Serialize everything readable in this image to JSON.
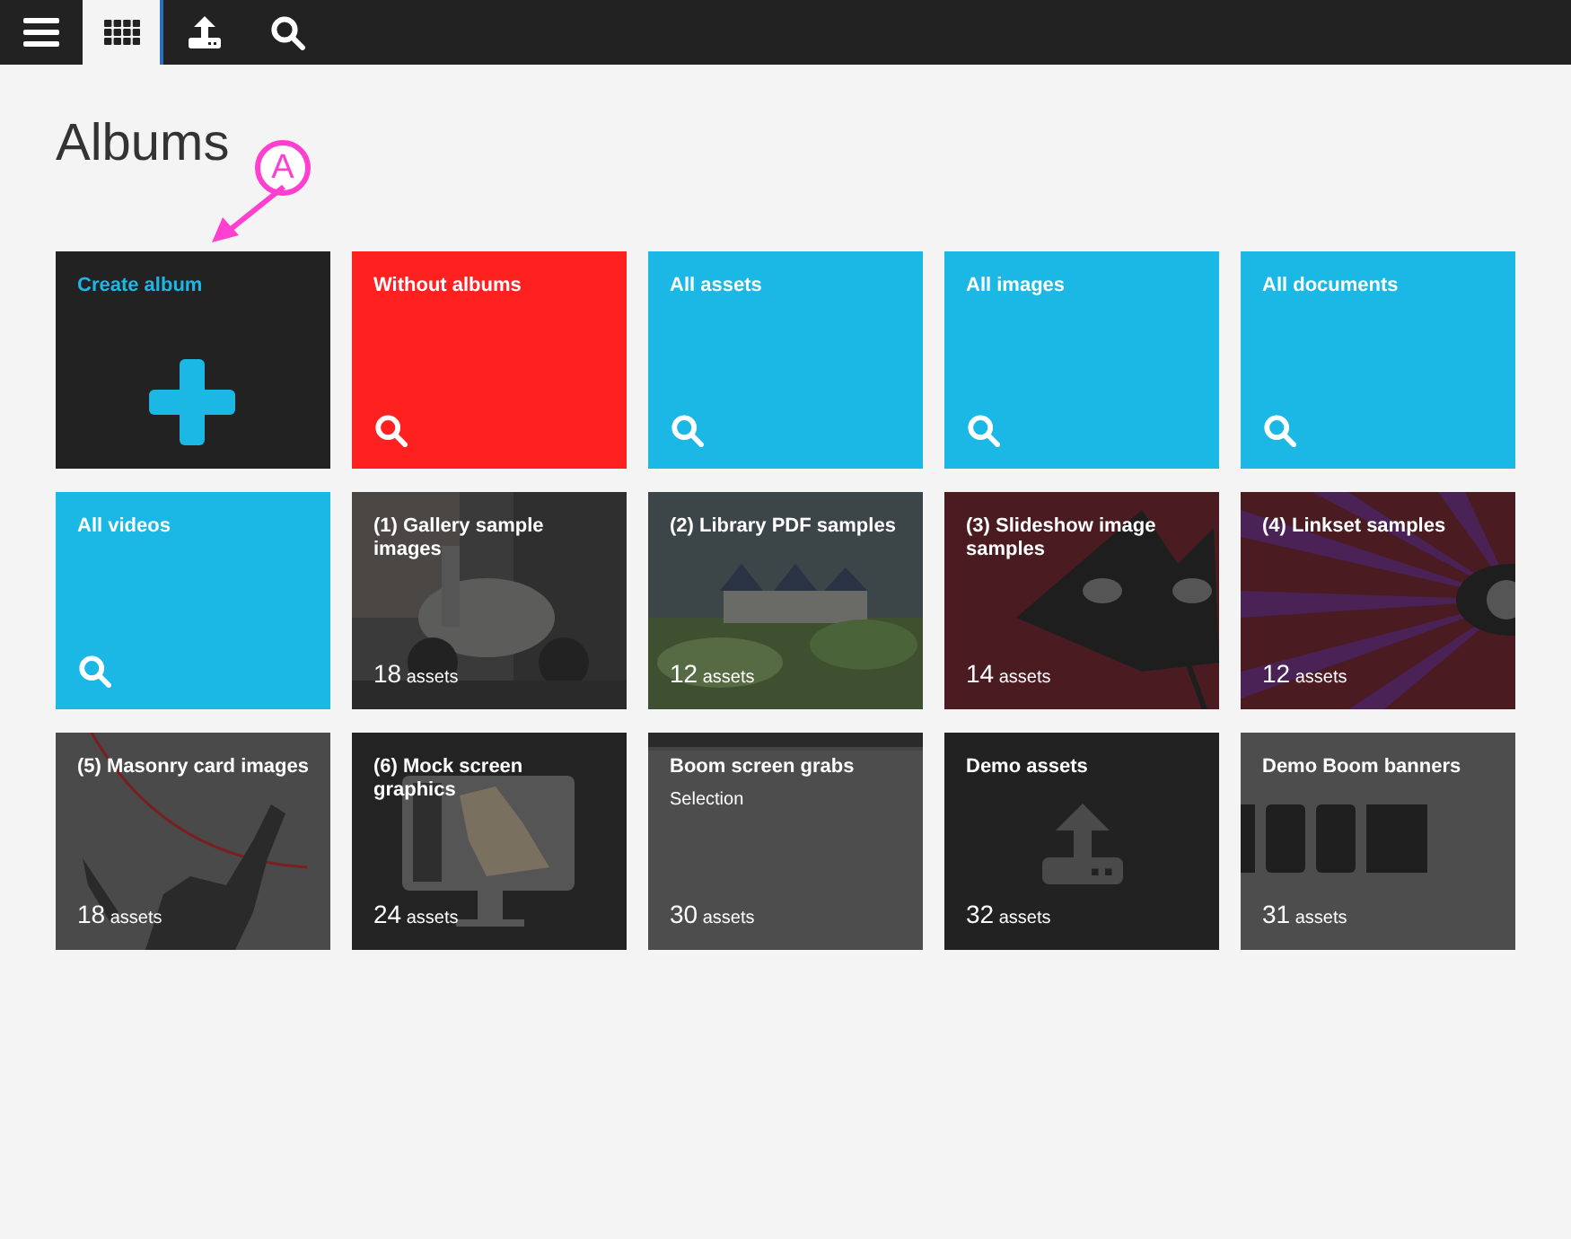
{
  "toolbar": {
    "buttons": [
      {
        "kind": "menu",
        "selected": false
      },
      {
        "kind": "grid",
        "selected": true
      },
      {
        "kind": "upload",
        "selected": false
      },
      {
        "kind": "search",
        "selected": false
      }
    ]
  },
  "title": "Albums",
  "annotation": {
    "label": "A"
  },
  "tiles": [
    {
      "kind": "create",
      "title": "Create album"
    },
    {
      "kind": "search",
      "title": "Without albums",
      "color": "#ff2020"
    },
    {
      "kind": "search",
      "title": "All assets",
      "color": "#1bb8e6"
    },
    {
      "kind": "search",
      "title": "All images",
      "color": "#1bb8e6"
    },
    {
      "kind": "search",
      "title": "All documents",
      "color": "#1bb8e6"
    },
    {
      "kind": "search",
      "title": "All videos",
      "color": "#1bb8e6"
    },
    {
      "kind": "album",
      "title": "(1) Gallery sample images",
      "count": "18",
      "unit": "assets"
    },
    {
      "kind": "album",
      "title": "(2) Library PDF samples",
      "count": "12",
      "unit": "assets"
    },
    {
      "kind": "album",
      "title": "(3) Slideshow image samples",
      "count": "14",
      "unit": "assets"
    },
    {
      "kind": "album",
      "title": "(4) Linkset samples",
      "count": "12",
      "unit": "assets"
    },
    {
      "kind": "album",
      "title": "(5) Masonry card images",
      "count": "18",
      "unit": "assets"
    },
    {
      "kind": "album",
      "title": "(6) Mock screen graphics",
      "count": "24",
      "unit": "assets"
    },
    {
      "kind": "album",
      "title": "Boom screen grabs",
      "subtitle": "Selection",
      "count": "30",
      "unit": "assets"
    },
    {
      "kind": "album",
      "title": "Demo assets",
      "count": "32",
      "unit": "assets"
    },
    {
      "kind": "album",
      "title": "Demo Boom banners",
      "count": "31",
      "unit": "assets"
    }
  ]
}
